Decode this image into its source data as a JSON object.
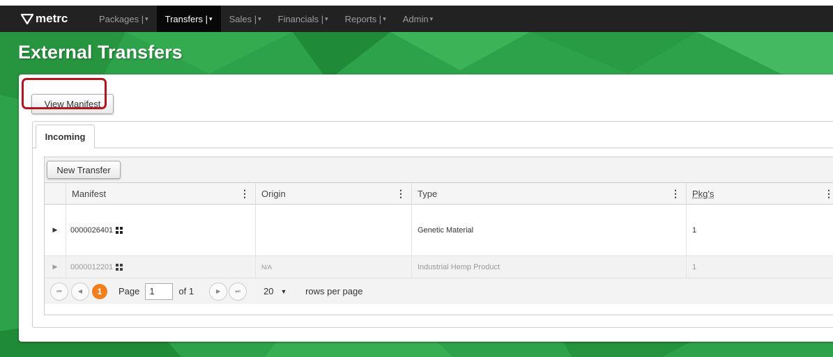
{
  "nav": {
    "brand": "metrc",
    "items": [
      {
        "label": "Packages |",
        "caret": "▾",
        "active": false
      },
      {
        "label": "Transfers |",
        "caret": "▾",
        "active": true
      },
      {
        "label": "Sales |",
        "caret": "▾",
        "active": false
      },
      {
        "label": "Financials |",
        "caret": "▾",
        "active": false
      },
      {
        "label": "Reports |",
        "caret": "▾",
        "active": false
      },
      {
        "label": "Admin",
        "caret": "▾",
        "active": false
      }
    ]
  },
  "page": {
    "title": "External Transfers"
  },
  "toolbar": {
    "view_manifest_label": "View Manifest"
  },
  "tabs": [
    {
      "label": "Incoming",
      "active": true
    }
  ],
  "grid": {
    "new_transfer_label": "New Transfer",
    "columns": [
      "Manifest",
      "Origin",
      "Type",
      "Pkg's"
    ],
    "column_menu_glyph": "⋮",
    "rows": [
      {
        "manifest": "0000026401",
        "origin": "",
        "type": "Genetic Material",
        "pkgs": "1",
        "dim": false
      },
      {
        "manifest": "0000012201",
        "origin": "N/A",
        "type": "Industrial Hemp Product",
        "pkgs": "1",
        "dim": true
      }
    ],
    "pager": {
      "first_glyph": "⏮",
      "prev_glyph": "◀",
      "next_glyph": "▶",
      "last_glyph": "⏭",
      "current_page_badge": "1",
      "page_label": "Page",
      "page_value": "1",
      "of_label": "of 1",
      "rows_per_page_value": "20",
      "rows_per_page_caret": "▼",
      "rows_per_page_label": "rows per page"
    }
  },
  "colors": {
    "brand_green": "#2ea24a",
    "highlight_red": "#b0161b",
    "badge_orange": "#f07f1d",
    "navbar": "#222222"
  }
}
